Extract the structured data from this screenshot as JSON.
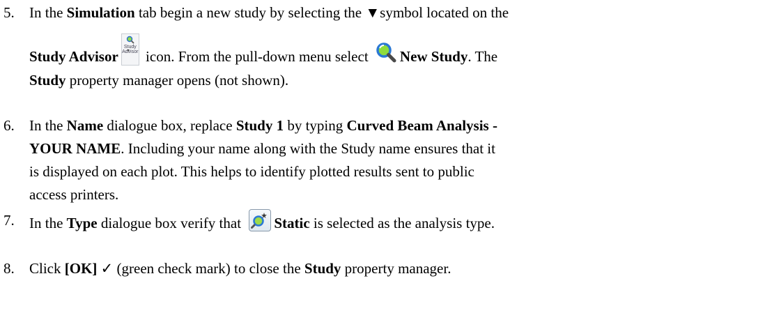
{
  "steps": [
    {
      "number": "5.",
      "text": {
        "a": "In the ",
        "b": "Simulation",
        "c": " tab begin a new study by selecting the ",
        "d": "▼",
        "e": "symbol located on the",
        "f": "Study Advisor",
        "g": " icon.  From the pull-down menu select ",
        "h": "New Study",
        "i": ".  The",
        "j": "Study",
        "k": " property manager opens (not shown)."
      },
      "study_advisor_icon_text": [
        "Study",
        "Advisor"
      ]
    },
    {
      "number": "6.",
      "text": {
        "a": " In the ",
        "b": "Name",
        "c": " dialogue box, replace ",
        "d": "Study 1",
        "e": " by typing ",
        "f": "Curved Beam Analysis -",
        "g": "YOUR NAME",
        "h": ".  Including your name along with the Study name ensures that it",
        "i": "is displayed on each plot.  This helps to identify plotted results sent to public",
        "j": "access printers."
      }
    },
    {
      "number": "7.",
      "text": {
        "a": "In the ",
        "b": "Type",
        "c": " dialogue box verify that ",
        "d": "Static",
        "e": " is selected as the analysis type."
      }
    },
    {
      "number": "8.",
      "text": {
        "a": "Click ",
        "b": "[OK]",
        "c": " ✓",
        "d": " (green check mark) to close the ",
        "e": "Study",
        "f": " property manager."
      }
    }
  ],
  "icons": [
    "study-advisor-icon",
    "new-study-magnifier-icon",
    "static-study-icon"
  ],
  "colors": {
    "text": "#000000",
    "background": "#ffffff",
    "magnifier_ring": "#2c7bd6",
    "magnifier_fill": "#7fd63a"
  }
}
